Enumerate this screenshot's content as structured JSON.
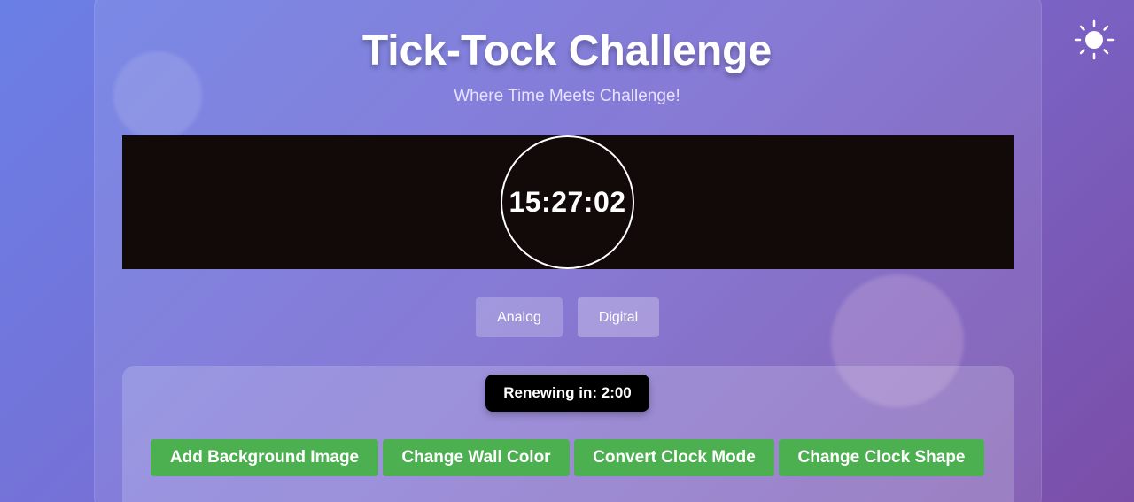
{
  "header": {
    "title": "Tick-Tock Challenge",
    "subtitle": "Where Time Meets Challenge!"
  },
  "clock": {
    "time": "15:27:02",
    "wall_color": "#120909",
    "border_color": "#ffffff"
  },
  "mode_buttons": {
    "analog_label": "Analog",
    "digital_label": "Digital"
  },
  "panel": {
    "renew_text": "Renewing in: 2:00",
    "actions": [
      "Add Background Image",
      "Change Wall Color",
      "Convert Clock Mode",
      "Change Clock Shape"
    ],
    "action_color": "#4caf50"
  },
  "theme_toggle": {
    "icon": "sun-icon"
  }
}
